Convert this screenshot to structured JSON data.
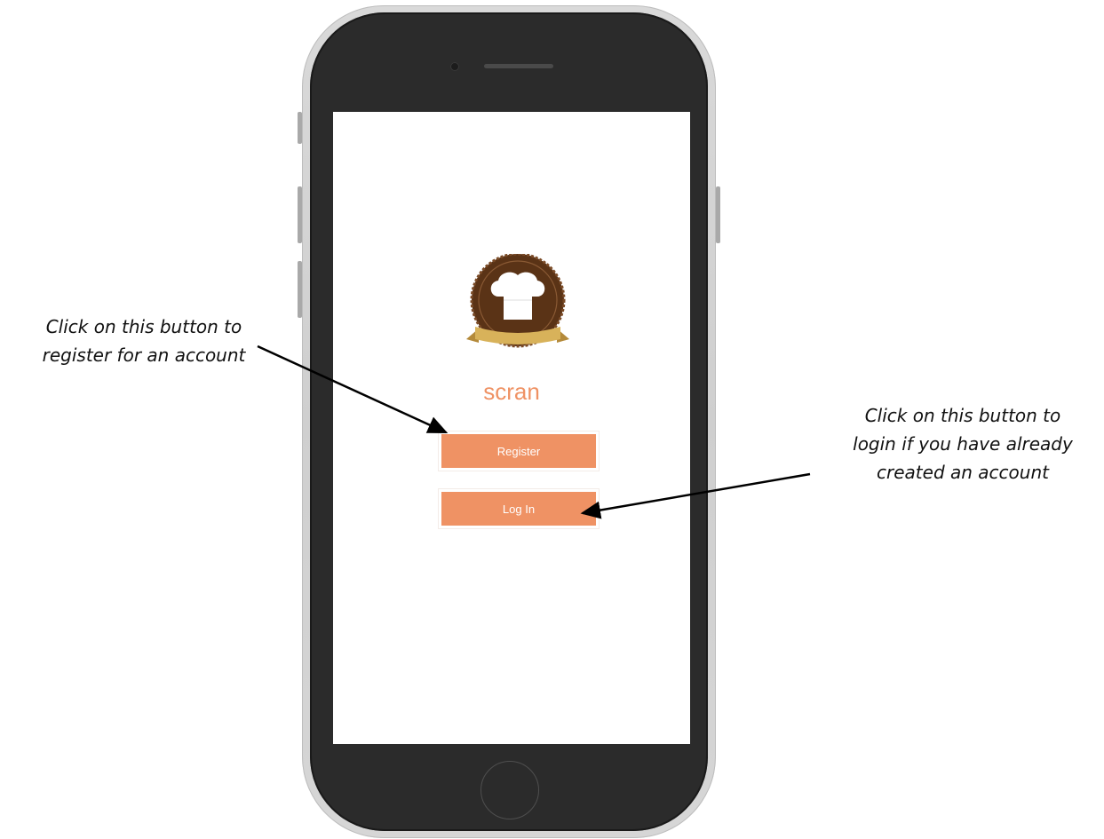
{
  "app": {
    "name": "scran",
    "logo_icon": "chef-hat-badge-icon",
    "accent_color": "#ef9264",
    "badge_color": "#5a3316",
    "ribbon_color": "#d8b25a"
  },
  "buttons": {
    "register_label": "Register",
    "login_label": "Log In"
  },
  "annotations": {
    "left_line1": "Click on this button to",
    "left_line2": "register for an account",
    "right_line1": "Click on this button to",
    "right_line2": "login if you have already",
    "right_line3": "created an account"
  }
}
